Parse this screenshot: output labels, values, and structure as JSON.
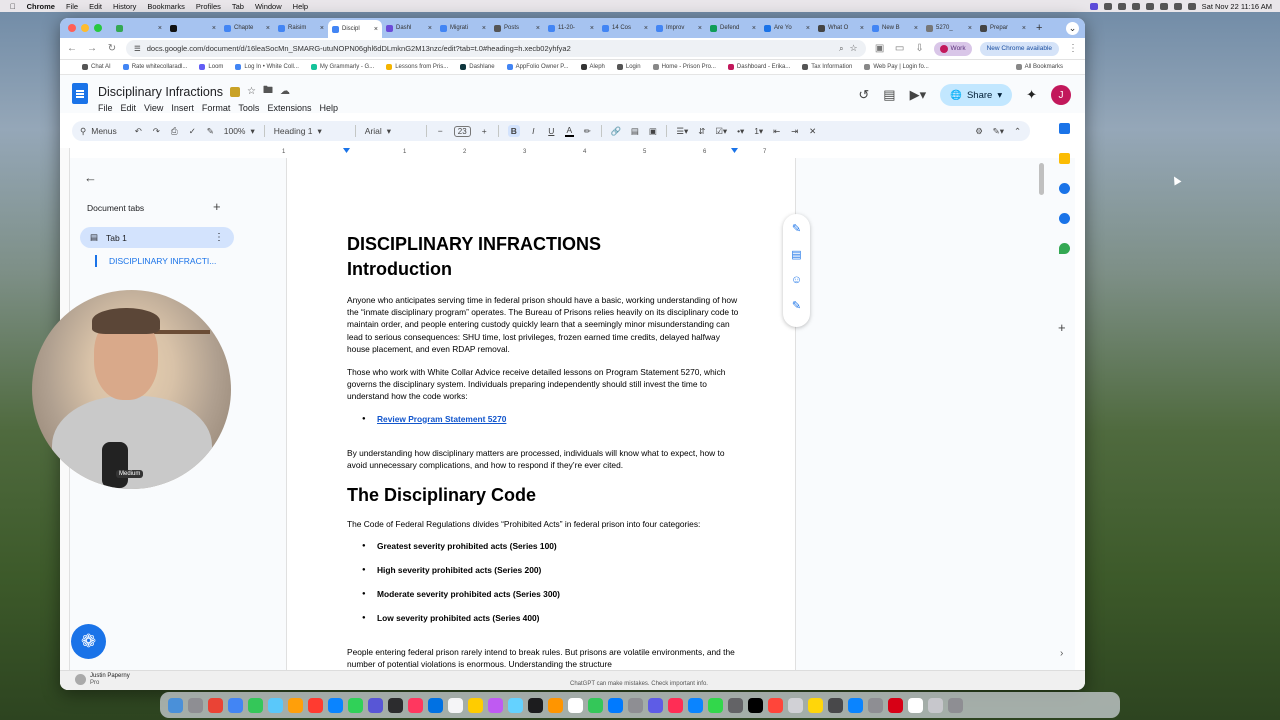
{
  "macos": {
    "app_name": "Chrome",
    "menus": [
      "File",
      "Edit",
      "History",
      "Bookmarks",
      "Profiles",
      "Tab",
      "Window",
      "Help"
    ],
    "clock": "Sat Nov 22  11:16 AM"
  },
  "browser": {
    "tabs": [
      {
        "label": "",
        "color": "#34a853"
      },
      {
        "label": "",
        "color": "#111111"
      },
      {
        "label": "Chapte",
        "color": "#4285f4"
      },
      {
        "label": "Raisim",
        "color": "#4285f4"
      },
      {
        "label": "Discipl",
        "color": "#4285f4",
        "active": true
      },
      {
        "label": "Dashl",
        "color": "#6b4bd8"
      },
      {
        "label": "Migrati",
        "color": "#4285f4"
      },
      {
        "label": "Posts",
        "color": "#555555"
      },
      {
        "label": "11-20-",
        "color": "#4285f4"
      },
      {
        "label": "14 Cos",
        "color": "#4285f4"
      },
      {
        "label": "Improv",
        "color": "#4285f4"
      },
      {
        "label": "Defend",
        "color": "#0f9d58"
      },
      {
        "label": "Are Yo",
        "color": "#1a73e8"
      },
      {
        "label": "What O",
        "color": "#444444"
      },
      {
        "label": "New B",
        "color": "#4285f4"
      },
      {
        "label": "5270_",
        "color": "#777777"
      },
      {
        "label": "Prepar",
        "color": "#444444"
      }
    ],
    "url": "docs.google.com/document/d/16leaSocMn_SMARG-utuNOPN06ghl6dDLmknG2M13nzc/edit?tab=t.0#heading=h.xecb02yhfya2",
    "profile_label": "Work",
    "update_label": "New Chrome available",
    "bookmarks": [
      {
        "label": "Chat AI",
        "color": "#555555"
      },
      {
        "label": "Rate whitecollaradl...",
        "color": "#4285f4"
      },
      {
        "label": "Loom",
        "color": "#625df5"
      },
      {
        "label": "Log In • White Coll...",
        "color": "#4285f4"
      },
      {
        "label": "My Grammarly - G...",
        "color": "#15c39a"
      },
      {
        "label": "Lessons from Pris...",
        "color": "#f4b400"
      },
      {
        "label": "Dashlane",
        "color": "#0e353d"
      },
      {
        "label": "AppFolio Owner P...",
        "color": "#4285f4"
      },
      {
        "label": "Aleph",
        "color": "#333333"
      },
      {
        "label": "Login",
        "color": "#555555"
      },
      {
        "label": "Home - Prison Pro...",
        "color": "#888888"
      },
      {
        "label": "Dashboard - Erika...",
        "color": "#c2185b"
      },
      {
        "label": "Tax Information",
        "color": "#555555"
      },
      {
        "label": "Web Pay | Login fo...",
        "color": "#888888"
      }
    ],
    "all_bookmarks": "All Bookmarks"
  },
  "docs": {
    "title": "Disciplinary Infractions",
    "menus": [
      "File",
      "Edit",
      "View",
      "Insert",
      "Format",
      "Tools",
      "Extensions",
      "Help"
    ],
    "share_label": "Share",
    "avatar_letter": "J",
    "toolbar": {
      "menus_label": "Menus",
      "zoom": "100%",
      "style": "Heading 1",
      "font": "Arial",
      "font_size": "23"
    },
    "ruler_numbers": [
      "1",
      "1",
      "2",
      "3",
      "4",
      "5",
      "6",
      "7"
    ]
  },
  "left_panel": {
    "header": "Document tabs",
    "tab_label": "Tab 1",
    "outline_item": "DISCIPLINARY INFRACTI...",
    "webcam_label": "Medium"
  },
  "document": {
    "heading1": "DISCIPLINARY INFRACTIONS",
    "heading1b": "Introduction",
    "para1": "Anyone who anticipates serving time in federal prison should have a basic, working understanding of how the “inmate disciplinary program” operates. The Bureau of Prisons relies heavily on its disciplinary code to maintain order, and people entering custody quickly learn that a seemingly minor misunderstanding can lead to serious consequences: SHU time, lost privileges, frozen earned time credits, delayed halfway house placement, and even RDAP removal.",
    "para2": "Those who work with White Collar Advice receive detailed lessons on Program Statement 5270, which governs the disciplinary system. Individuals preparing independently should still invest the time to understand how the code works:",
    "link": "Review Program Statement 5270",
    "para3": "By understanding how disciplinary matters are processed, individuals will know what to expect, how to avoid unnecessary complications, and how to respond if they’re ever cited.",
    "heading2": "The Disciplinary Code",
    "para4": "The Code of Federal Regulations divides “Prohibited Acts” in federal prison into four categories:",
    "categories": [
      "Greatest severity prohibited acts (Series 100)",
      "High severity prohibited acts (Series 200)",
      "Moderate severity prohibited acts (Series 300)",
      "Low severity prohibited acts (Series 400)"
    ],
    "para5": "People entering federal prison rarely intend to break rules. But prisons are volatile environments, and the number of potential violations is enormous. Understanding the structure"
  },
  "bottom_bar": {
    "user_name": "Justin Paperny",
    "user_plan": "Pro",
    "disclaimer": "ChatGPT can make mistakes. Check important info."
  },
  "dock_colors": [
    "#4a90d9",
    "#8e8e93",
    "#ea4335",
    "#4285f4",
    "#34c759",
    "#5ac8fa",
    "#ff9f0a",
    "#ff3b30",
    "#0a84ff",
    "#30d158",
    "#5856d6",
    "#2c2c2e",
    "#ff375f",
    "#0071e3",
    "#f5f5f7",
    "#ffcc00",
    "#bf5af2",
    "#64d2ff",
    "#1c1c1e",
    "#ff9500",
    "#ffffff",
    "#34c759",
    "#007aff",
    "#8e8e93",
    "#5e5ce6",
    "#ff2d55",
    "#0a84ff",
    "#32d74b",
    "#636366",
    "#000000",
    "#ff453a",
    "#d1d1d6",
    "#ffd60a",
    "#48484a",
    "#0a84ff",
    "#8e8e93",
    "#d70015",
    "#ffffff",
    "#c7c7cc",
    "#8e8e93"
  ]
}
